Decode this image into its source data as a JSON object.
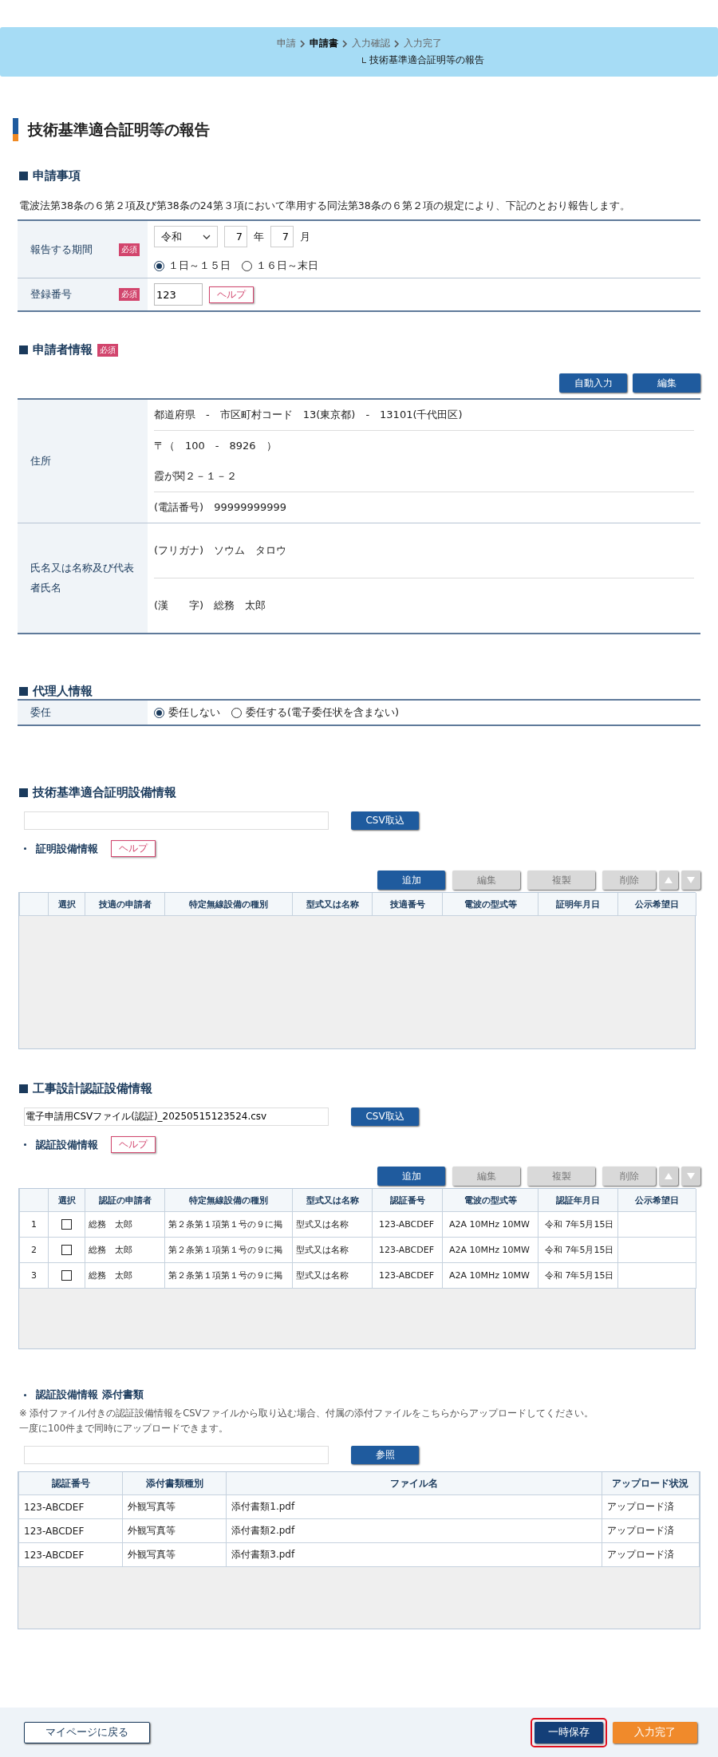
{
  "breadcrumb": {
    "steps": [
      {
        "label": "申請",
        "selected": false
      },
      {
        "label": "申請書",
        "selected": true
      },
      {
        "label": "入力確認",
        "selected": false
      },
      {
        "label": "入力完了",
        "selected": false
      }
    ],
    "sub": "技術基準適合証明等の報告"
  },
  "title": "技術基準適合証明等の報告",
  "application": {
    "heading": "申請事項",
    "description": "電波法第38条の６第２項及び第38条の24第３項において準用する同法第38条の６第２項の規定により、下記のとおり報告します。",
    "period": {
      "label": "報告する期間",
      "required": "必須",
      "era": "令和",
      "year": "7",
      "year_unit": "年",
      "month": "7",
      "month_unit": "月",
      "options": [
        {
          "label": "１日～１５日",
          "selected": true
        },
        {
          "label": "１６日～末日",
          "selected": false
        }
      ]
    },
    "registration": {
      "label": "登録番号",
      "required": "必須",
      "value": "123",
      "help": "ヘルプ"
    }
  },
  "applicant": {
    "heading": "申請者情報",
    "required": "必須",
    "buttons": [
      "自動入力",
      "編集"
    ],
    "address": {
      "label": "住所",
      "groups": [
        [
          "都道府県　-　市区町村コード　13(東京都)　-　13101(千代田区)"
        ],
        [
          "〒（　100　-　8926　）",
          "霞が関２－１－２"
        ],
        [
          "(電話番号)　99999999999"
        ]
      ]
    },
    "name": {
      "label": "氏名又は名称及び代表者氏名",
      "groups": [
        [
          "(フリガナ)　ソウム　タロウ"
        ],
        [
          "(漢　　字)　総務　太郎"
        ]
      ]
    }
  },
  "agent": {
    "heading": "代理人情報",
    "label": "委任",
    "options": [
      {
        "label": "委任しない",
        "selected": true
      },
      {
        "label": "委任する(電子委任状を含まない)",
        "selected": false
      }
    ]
  },
  "equipment_sections": [
    {
      "heading": "技術基準適合証明設備情報",
      "csv_button": "CSV取込",
      "subheading": "証明設備情報",
      "help": "ヘルプ",
      "toolbar": [
        {
          "label": "追加",
          "disabled": false
        },
        {
          "label": "編集",
          "disabled": true
        },
        {
          "label": "複製",
          "disabled": true
        },
        {
          "label": "削除",
          "disabled": true
        }
      ],
      "arrows_disabled": true,
      "columns": [
        "",
        "選択",
        "技適の申請者",
        "特定無線設備の種別",
        "型式又は名称",
        "技適番号",
        "電波の型式等",
        "証明年月日",
        "公示希望日"
      ]
    },
    {
      "heading": "工事設計認証設備情報",
      "file": "電子申請用CSVファイル(認証)_20250515123524.csv",
      "csv_button": "CSV取込",
      "subheading": "認証設備情報",
      "help": "ヘルプ",
      "toolbar": [
        {
          "label": "追加",
          "disabled": false
        },
        {
          "label": "編集",
          "disabled": true
        },
        {
          "label": "複製",
          "disabled": true
        },
        {
          "label": "削除",
          "disabled": true
        }
      ],
      "arrows_disabled": true,
      "columns": [
        "",
        "選択",
        "認証の申請者",
        "特定無線設備の種別",
        "型式又は名称",
        "認証番号",
        "電波の型式等",
        "認証年月日",
        "公示希望日"
      ],
      "rows": [
        {
          "checked": false,
          "cells": [
            "1",
            "",
            "総務　太郎",
            "第２条第１項第１号の９に掲",
            "型式又は名称",
            "123-ABCDEF",
            "A2A 10MHz 10MW",
            "令和 7年5月15日",
            ""
          ]
        },
        {
          "checked": false,
          "cells": [
            "2",
            "",
            "総務　太郎",
            "第２条第１項第１号の９に掲",
            "型式又は名称",
            "123-ABCDEF",
            "A2A 10MHz 10MW",
            "令和 7年5月15日",
            ""
          ]
        },
        {
          "checked": false,
          "cells": [
            "3",
            "",
            "総務　太郎",
            "第２条第１項第１号の９に掲",
            "型式又は名称",
            "123-ABCDEF",
            "A2A 10MHz 10MW",
            "令和 7年5月15日",
            ""
          ]
        }
      ]
    }
  ],
  "attachments": {
    "heading": "認証設備情報 添付書類",
    "notes": [
      "※ 添付ファイル付きの認証設備情報をCSVファイルから取り込む場合、付属の添付ファイルをこちらからアップロードしてください。",
      "一度に100件まで同時にアップロードできます。"
    ],
    "browse": "参照",
    "columns": [
      "認証番号",
      "添付書類種別",
      "ファイル名",
      "アップロード状況"
    ],
    "rows": [
      [
        "123-ABCDEF",
        "外観写真等",
        "添付書類1.pdf",
        "アップロード済"
      ],
      [
        "123-ABCDEF",
        "外観写真等",
        "添付書類2.pdf",
        "アップロード済"
      ],
      [
        "123-ABCDEF",
        "外観写真等",
        "添付書類3.pdf",
        "アップロード済"
      ]
    ]
  },
  "footer": {
    "back": "マイページに戻る",
    "buttons": [
      {
        "label": "一時保存",
        "kind": "save",
        "highlighted": true
      },
      {
        "label": "入力完了",
        "kind": "complete",
        "highlighted": false
      }
    ]
  }
}
